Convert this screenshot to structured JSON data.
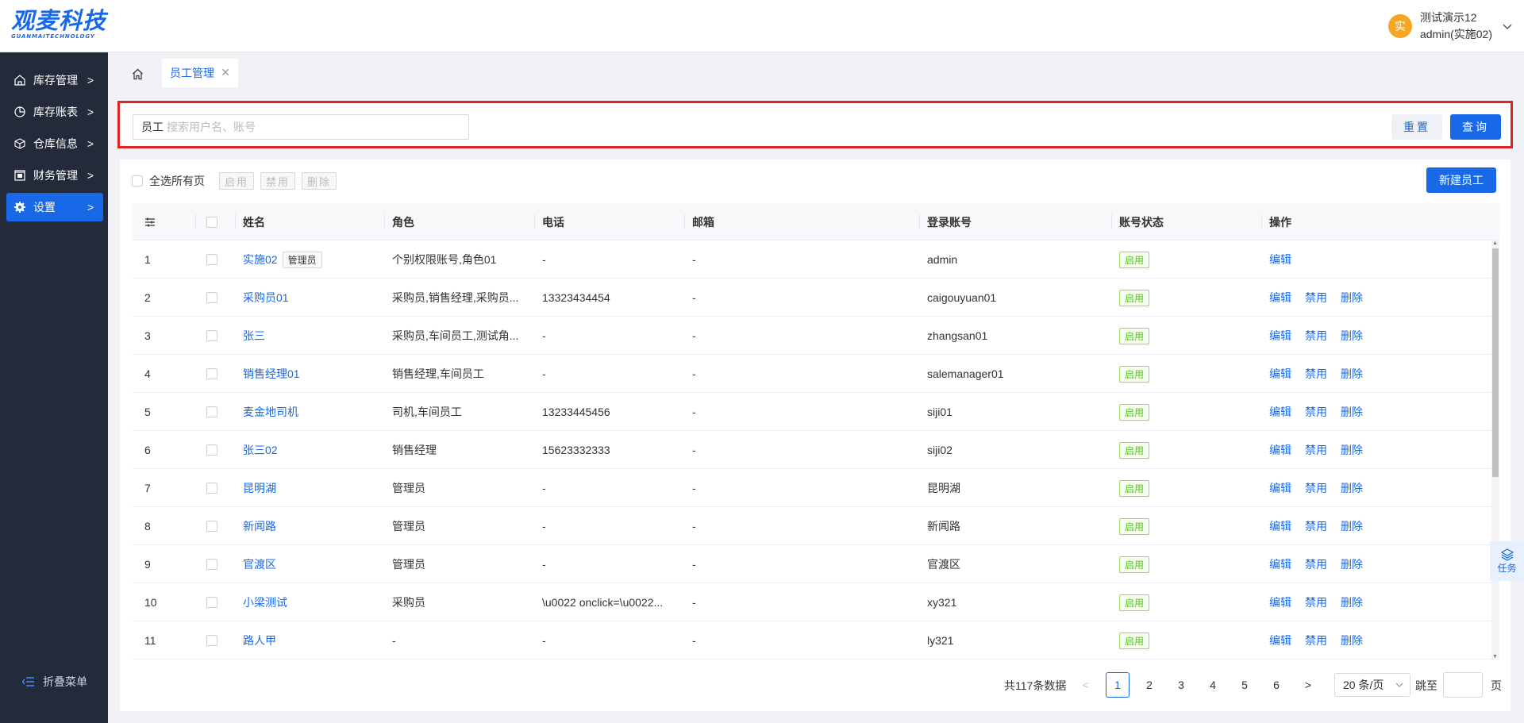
{
  "brand": {
    "logo_main": "观麦科技",
    "logo_sub": "GUANMAITECHNOLOGY",
    "color": "#1769e8"
  },
  "user": {
    "avatar_char": "实",
    "name": "测试演示12",
    "account": "admin(实施02)"
  },
  "sidebar": {
    "items": [
      {
        "label": "库存管理",
        "icon": "warehouse-icon"
      },
      {
        "label": "库存账表",
        "icon": "pie-chart-icon"
      },
      {
        "label": "仓库信息",
        "icon": "box-icon"
      },
      {
        "label": "财务管理",
        "icon": "finance-icon"
      },
      {
        "label": "设置",
        "icon": "gear-icon"
      }
    ],
    "collapse_label": "折叠菜单"
  },
  "tabs": {
    "active_label": "员工管理"
  },
  "search": {
    "label": "员工",
    "placeholder": "搜索用户名、账号",
    "value": "",
    "reset_label": "重置",
    "query_label": "查询"
  },
  "toolbar": {
    "select_all_label": "全选所有页",
    "enable_label": "启用",
    "disable_label": "禁用",
    "delete_label": "删除",
    "new_label": "新建员工"
  },
  "table": {
    "columns": [
      "姓名",
      "角色",
      "电话",
      "邮箱",
      "登录账号",
      "账号状态",
      "操作"
    ],
    "ops": {
      "edit": "编辑",
      "disable": "禁用",
      "delete": "删除"
    },
    "rows": [
      {
        "idx": "1",
        "name": "实施02",
        "tag": "管理员",
        "role": "个别权限账号,角色01",
        "phone": "-",
        "email": "-",
        "account": "admin",
        "status": "启用"
      },
      {
        "idx": "2",
        "name": "采购员01",
        "tag": "",
        "role": "采购员,销售经理,采购员...",
        "phone": "13323434454",
        "email": "-",
        "account": "caigouyuan01",
        "status": "启用"
      },
      {
        "idx": "3",
        "name": "张三",
        "tag": "",
        "role": "采购员,车间员工,测试角...",
        "phone": "-",
        "email": "-",
        "account": "zhangsan01",
        "status": "启用"
      },
      {
        "idx": "4",
        "name": "销售经理01",
        "tag": "",
        "role": "销售经理,车间员工",
        "phone": "-",
        "email": "-",
        "account": "salemanager01",
        "status": "启用"
      },
      {
        "idx": "5",
        "name": "麦金地司机",
        "tag": "",
        "role": "司机,车间员工",
        "phone": "13233445456",
        "email": "-",
        "account": "siji01",
        "status": "启用"
      },
      {
        "idx": "6",
        "name": "张三02",
        "tag": "",
        "role": "销售经理",
        "phone": "15623332333",
        "email": "-",
        "account": "siji02",
        "status": "启用"
      },
      {
        "idx": "7",
        "name": "昆明湖",
        "tag": "",
        "role": "管理员",
        "phone": "-",
        "email": "-",
        "account": "昆明湖",
        "status": "启用"
      },
      {
        "idx": "8",
        "name": "新闻路",
        "tag": "",
        "role": "管理员",
        "phone": "-",
        "email": "-",
        "account": "新闻路",
        "status": "启用"
      },
      {
        "idx": "9",
        "name": "官渡区",
        "tag": "",
        "role": "管理员",
        "phone": "-",
        "email": "-",
        "account": "官渡区",
        "status": "启用"
      },
      {
        "idx": "10",
        "name": "小梁测试",
        "tag": "",
        "role": "采购员",
        "phone": "\\u0022 onclick=\\u0022...",
        "email": "-",
        "account": "xy321",
        "status": "启用"
      },
      {
        "idx": "11",
        "name": "路人甲",
        "tag": "",
        "role": "-",
        "phone": "-",
        "email": "-",
        "account": "ly321",
        "status": "启用"
      }
    ]
  },
  "pagination": {
    "total_label": "共117条数据",
    "pages": [
      "1",
      "2",
      "3",
      "4",
      "5",
      "6"
    ],
    "current": "1",
    "prev": "<",
    "next": ">",
    "page_size": "20 条/页",
    "jump_label": "跳至",
    "page_label": "页"
  },
  "task_float": {
    "label": "任务"
  }
}
